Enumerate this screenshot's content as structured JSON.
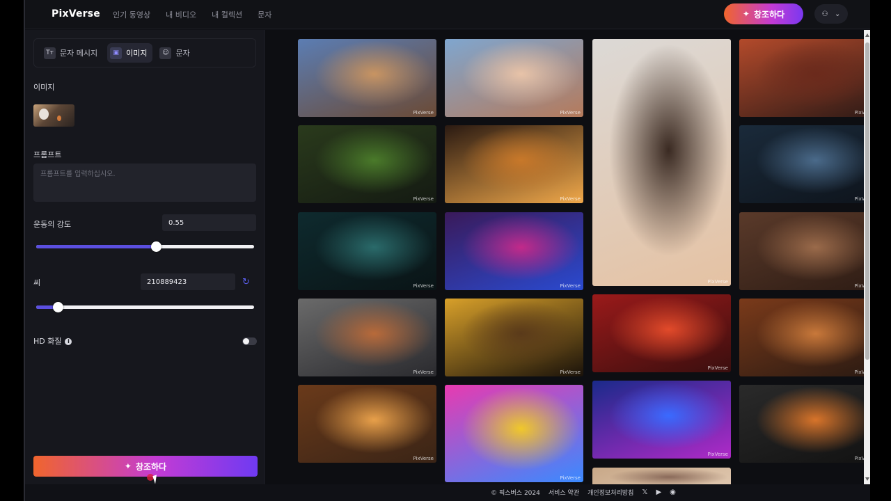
{
  "app": {
    "logo": "PixVerse",
    "nav": [
      "인기 동영상",
      "내 비디오",
      "내 컬렉션",
      "문자"
    ],
    "create_button": "창조하다"
  },
  "left_panel": {
    "tabs": [
      {
        "label": "문자 메시지",
        "icon": "Tт",
        "active": false
      },
      {
        "label": "이미지",
        "icon": "▣",
        "active": true
      },
      {
        "label": "문자",
        "icon": "☺",
        "active": false
      }
    ],
    "image_label": "이미지",
    "prompt_label": "프롬프트",
    "prompt_placeholder": "프롬프트를 입력하십시오.",
    "motion_label": "운동의 강도",
    "motion_value": "0.55",
    "motion_fraction": 0.55,
    "seed_label": "씨",
    "seed_value": "210889423",
    "seed_fraction": 0.1,
    "hd_label": "HD 화질",
    "hd_enabled": false,
    "create_button": "창조하다"
  },
  "gallery": {
    "watermark": "PixVerse",
    "tiles": [
      {
        "colors": [
          "#5b7db3",
          "#c89462",
          "#6b4a35"
        ]
      },
      {
        "colors": [
          "#7fa6cf",
          "#e8c3a8",
          "#b57a5b"
        ]
      },
      {
        "colors": [
          "#dcd9d6",
          "#3a2a22",
          "#e5c2a3"
        ]
      },
      {
        "colors": [
          "#b34a2b",
          "#6b2a1c",
          "#2e1a16"
        ]
      },
      {
        "colors": [
          "#2a3a1c",
          "#4a7a2a",
          "#141a12"
        ]
      },
      {
        "colors": [
          "#2a1a12",
          "#c8782a",
          "#f0a84a"
        ]
      },
      {
        "colors": [
          "#1a2a3a",
          "#4a6a8a",
          "#0e141c"
        ]
      },
      {
        "colors": [
          "#0e2a2e",
          "#2a6a6a",
          "#0a1416"
        ]
      },
      {
        "colors": [
          "#3a1a5a",
          "#c22a8a",
          "#2a4ad0"
        ]
      },
      {
        "colors": [
          "#5a3a2a",
          "#9a6a4a",
          "#2e1c14"
        ]
      },
      {
        "colors": [
          "#6a6a6a",
          "#b86a3a",
          "#2a2a2e"
        ]
      },
      {
        "colors": [
          "#d8a02a",
          "#5a3a1a",
          "#1a120a"
        ]
      },
      {
        "colors": [
          "#9a1a1a",
          "#e24a2a",
          "#3a0e0e"
        ]
      },
      {
        "colors": [
          "#7a3a1a",
          "#c8783a",
          "#2a1a12"
        ]
      },
      {
        "colors": [
          "#6a3a1a",
          "#e8a04a",
          "#3a2416"
        ]
      },
      {
        "colors": [
          "#e83ab0",
          "#f0c82a",
          "#3a8aff"
        ]
      },
      {
        "colors": [
          "#1a2a8a",
          "#3a6aff",
          "#b02ac8"
        ]
      },
      {
        "colors": [
          "#2a2a2a",
          "#d8742a",
          "#121212"
        ]
      },
      {
        "colors": [
          "#c8a888",
          "#8a6a5a",
          "#e0c8b0"
        ]
      }
    ]
  },
  "footer": {
    "copyright": "© 픽스버스 2024",
    "terms": "서비스 약관",
    "privacy": "개인정보처리방침",
    "icons": [
      "x-icon",
      "youtube-icon",
      "discord-icon"
    ]
  }
}
